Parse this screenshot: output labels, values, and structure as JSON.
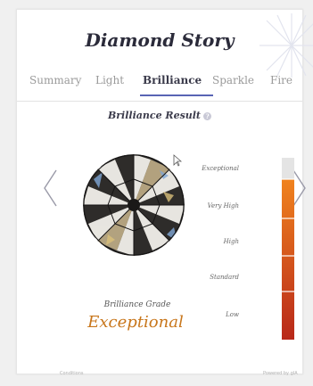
{
  "header": {
    "title": "Diamond Story"
  },
  "tabs": [
    {
      "label": "Summary",
      "active": false
    },
    {
      "label": "Light",
      "active": false
    },
    {
      "label": "Brilliance",
      "active": true
    },
    {
      "label": "Sparkle",
      "active": false
    },
    {
      "label": "Fire",
      "active": false
    }
  ],
  "result": {
    "title": "Brilliance Result",
    "help": "?",
    "grade_label": "Brilliance Grade",
    "grade_value": "Exceptional",
    "grade_color": "#c8761b"
  },
  "scale": {
    "levels": [
      "Exceptional",
      "Very High",
      "High",
      "Standard",
      "Low"
    ],
    "current_level": "Exceptional",
    "gradient_top": "#f0831e",
    "gradient_bottom": "#b8281a",
    "empty_color": "#e4e4e4"
  },
  "nav": {
    "prev_icon": "chevron-left-icon",
    "next_icon": "chevron-right-icon"
  },
  "footer": {
    "left": "Conditions",
    "right": "Powered by gIA"
  }
}
